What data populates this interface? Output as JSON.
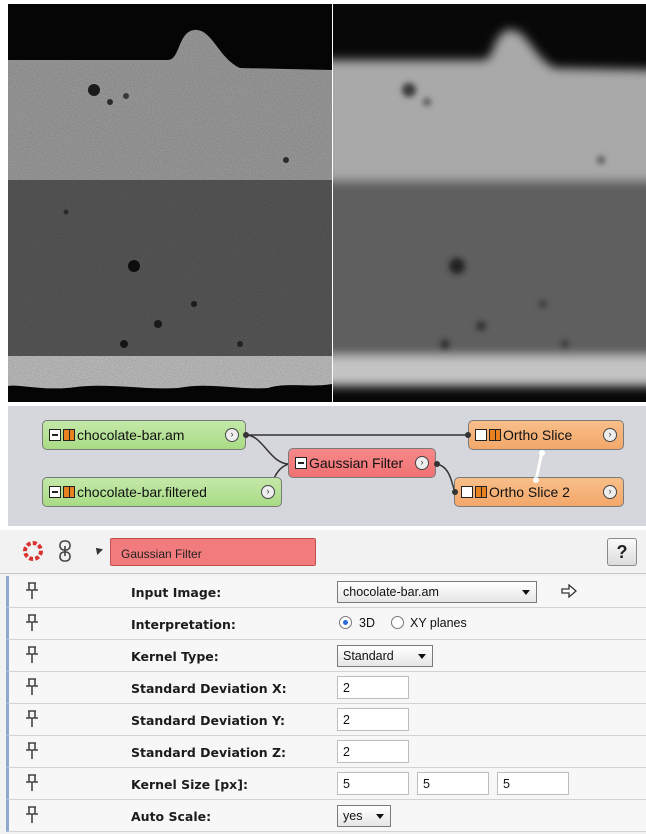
{
  "network": {
    "nodes": [
      {
        "label": "chocolate-bar.am",
        "type": "data"
      },
      {
        "label": "chocolate-bar.filtered",
        "type": "data"
      },
      {
        "label": "Gaussian Filter",
        "type": "compute"
      },
      {
        "label": "Ortho Slice",
        "type": "display"
      },
      {
        "label": "Ortho Slice 2",
        "type": "display"
      }
    ]
  },
  "properties": {
    "module_name": "Gaussian Filter",
    "help_label": "?",
    "rows": [
      {
        "label": "Input Image:",
        "value": "chocolate-bar.am"
      },
      {
        "label": "Interpretation:",
        "options": [
          "3D",
          "XY planes"
        ],
        "selected": "3D"
      },
      {
        "label": "Kernel Type:",
        "value": "Standard"
      },
      {
        "label": "Standard Deviation X:",
        "value": "2"
      },
      {
        "label": "Standard Deviation Y:",
        "value": "2"
      },
      {
        "label": "Standard Deviation Z:",
        "value": "2"
      },
      {
        "label": "Kernel Size [px]:",
        "values": [
          "5",
          "5",
          "5"
        ]
      },
      {
        "label": "Auto Scale:",
        "value": "yes"
      }
    ]
  },
  "colors": {
    "data_node": "#a9dc86",
    "display_node": "#f3a76a",
    "compute_node": "#f07173",
    "pool_background": "#d6d7dc"
  }
}
